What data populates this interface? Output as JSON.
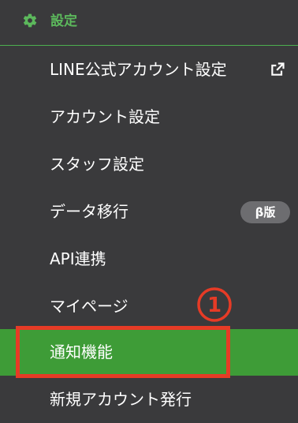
{
  "header": {
    "title": "設定",
    "icon": "gear-icon",
    "accent_color": "#5cb85c"
  },
  "menu": {
    "items": [
      {
        "label": "LINE公式アカウント設定",
        "icon": "external-link-icon"
      },
      {
        "label": "アカウント設定"
      },
      {
        "label": "スタッフ設定"
      },
      {
        "label": "データ移行",
        "badge": "β版"
      },
      {
        "label": "API連携"
      },
      {
        "label": "マイページ"
      },
      {
        "label": "通知機能",
        "active": true
      },
      {
        "label": "新規アカウント発行"
      }
    ]
  },
  "annotation": {
    "step_number": "1",
    "color": "#e63b26"
  }
}
